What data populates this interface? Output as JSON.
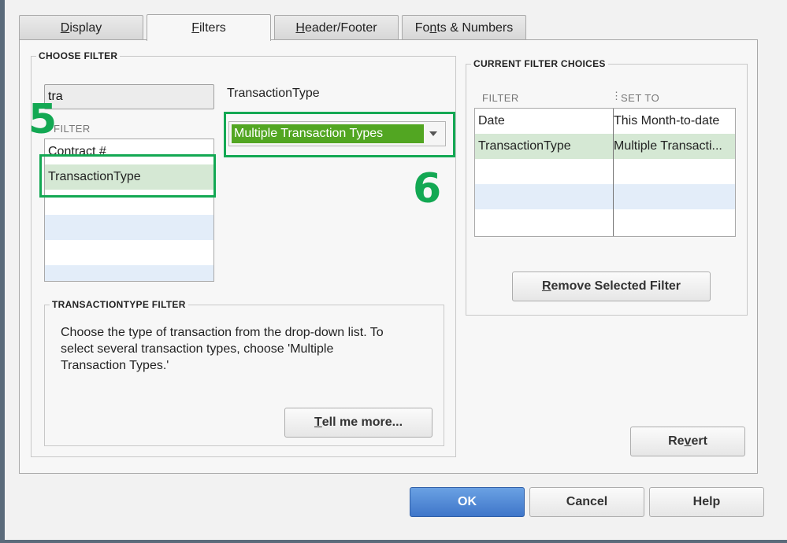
{
  "tabs": [
    {
      "label": "Display",
      "mnemonic": "D",
      "rest": "isplay"
    },
    {
      "label": "Filters",
      "mnemonic": "F",
      "rest": "ilters"
    },
    {
      "label": "Header/Footer",
      "mnemonic": "H",
      "rest": "eader/Footer"
    },
    {
      "label": "Fonts & Numbers",
      "pre": "Fo",
      "mnemonic": "n",
      "rest": "ts & Numbers"
    }
  ],
  "choose_filter": {
    "title": "CHOOSE FILTER",
    "search_value": "tra",
    "list_header": "FILTER",
    "items": [
      "Contract #",
      "TransactionType"
    ],
    "selected_label": "TransactionType",
    "dropdown_value": "Multiple Transaction Types"
  },
  "annotations": {
    "step5": "5",
    "step6": "6"
  },
  "description": {
    "title": "TRANSACTIONTYPE FILTER",
    "text_line1": "Choose the type of transaction from the drop-down list. To",
    "text_line2": "select several transaction types, choose 'Multiple",
    "text_line3": "Transaction Types.'",
    "tell_more_mnemonic": "T",
    "tell_more_rest": "ell me more..."
  },
  "current_filters": {
    "title": "CURRENT FILTER CHOICES",
    "col_filter": "FILTER",
    "col_set_to": "SET TO",
    "rows": [
      {
        "filter": "Date",
        "set_to": "This Month-to-date"
      },
      {
        "filter": "TransactionType",
        "set_to": "Multiple Transacti..."
      }
    ],
    "remove_mnemonic": "R",
    "remove_rest": "emove Selected Filter"
  },
  "buttons": {
    "revert_pre": "Re",
    "revert_mnemonic": "v",
    "revert_rest": "ert",
    "ok": "OK",
    "cancel": "Cancel",
    "help": "Help"
  },
  "colors": {
    "highlight_green": "#13a853",
    "dropdown_fill": "#52a622",
    "ok_blue": "#3f76c9"
  }
}
